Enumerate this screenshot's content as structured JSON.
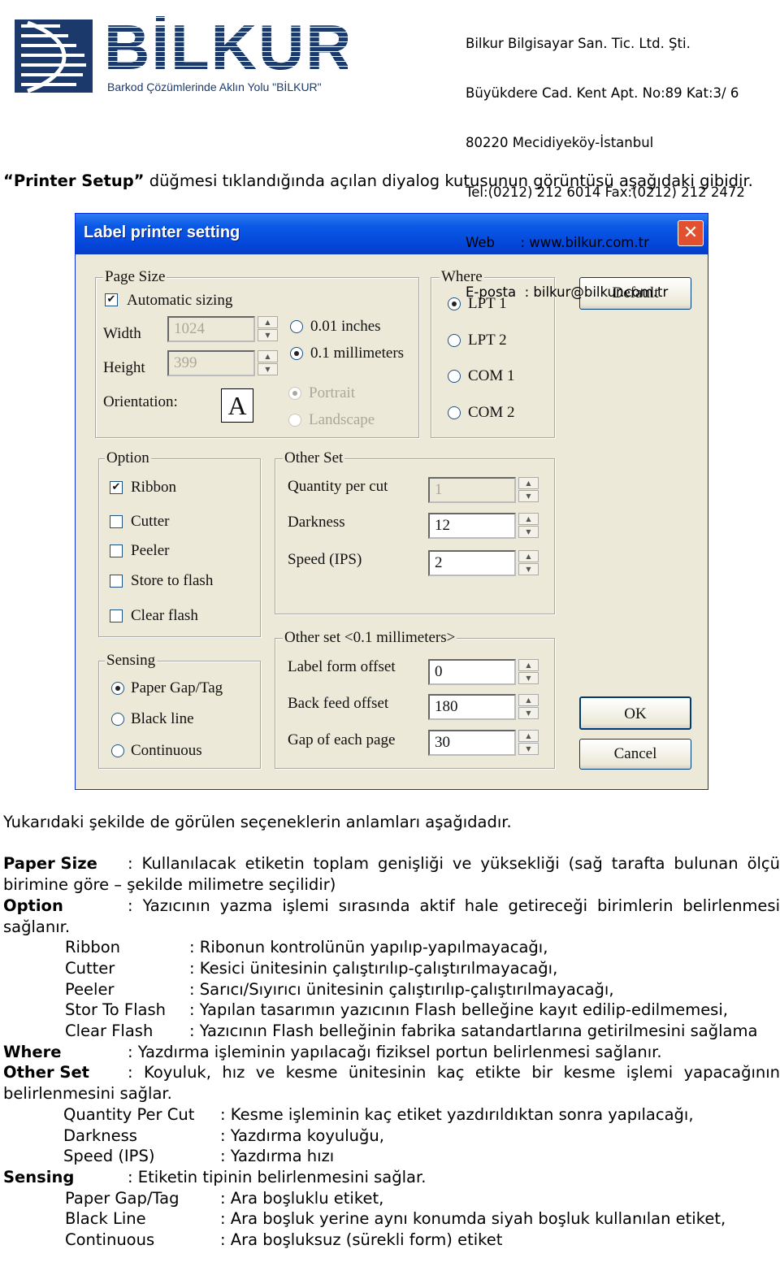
{
  "header": {
    "logo_text": "BİLKUR",
    "logo_slogan": "Barkod Çözümlerinde Aklın Yolu \"BİLKUR\"",
    "address_lines": [
      "Bilkur Bilgisayar San. Tic. Ltd. Şti.",
      "Büyükdere Cad. Kent Apt. No:89 Kat:3/ 6",
      "80220 Mecidiyeköy-İstanbul",
      "Tel:(0212) 212 6014 Fax:(0212) 212 2472",
      "Web      : www.bilkur.com.tr",
      "E-posta  : bilkur@bilkur.com.tr"
    ]
  },
  "intro": {
    "bold": "“Printer Setup”",
    "text": " düğmesi tıklandığında açılan diyalog kutusunun görüntüsü aşağıdaki gibidir."
  },
  "dialog": {
    "title": "Label printer setting",
    "close_icon": "close-icon",
    "page_size": {
      "legend": "Page Size",
      "automatic_sizing": {
        "label": "Automatic sizing",
        "checked": true
      },
      "width_label": "Width",
      "width_value": "1024",
      "height_label": "Height",
      "height_value": "399",
      "unit_inches": "0.01 inches",
      "unit_mm": "0.1 millimeters",
      "selected_unit": "0.1 millimeters",
      "orientation_label": "Orientation:",
      "orientation_icon_letter": "A",
      "portrait": "Portrait",
      "landscape": "Landscape",
      "selected_orientation": "Portrait"
    },
    "where": {
      "legend": "Where",
      "ports": [
        "LPT 1",
        "LPT 2",
        "COM 1",
        "COM 2"
      ],
      "selected": "LPT 1"
    },
    "default_button": "Default",
    "option": {
      "legend": "Option",
      "items": [
        {
          "label": "Ribbon",
          "checked": true
        },
        {
          "label": "Cutter",
          "checked": false
        },
        {
          "label": "Peeler",
          "checked": false
        },
        {
          "label": "Store to flash",
          "checked": false
        },
        {
          "label": "Clear flash",
          "checked": false
        }
      ]
    },
    "other_set": {
      "legend": "Other Set",
      "fields": [
        {
          "label": "Quantity per cut",
          "value": "1",
          "disabled": true
        },
        {
          "label": "Darkness",
          "value": "12"
        },
        {
          "label": "Speed (IPS)",
          "value": "2"
        }
      ]
    },
    "sensing": {
      "legend": "Sensing",
      "options": [
        "Paper Gap/Tag",
        "Black line",
        "Continuous"
      ],
      "selected": "Paper Gap/Tag"
    },
    "other_set_mm": {
      "legend": "Other set <0.1 millimeters>",
      "fields": [
        {
          "label": "Label form offset",
          "value": "0"
        },
        {
          "label": "Back feed offset",
          "value": "180"
        },
        {
          "label": "Gap of each page",
          "value": "30"
        }
      ]
    },
    "ok_button": "OK",
    "cancel_button": "Cancel"
  },
  "explanation": {
    "lead": "Yukarıdaki şekilde de görülen seçeneklerin anlamları aşağıdadır.",
    "paper_size": {
      "label": "Paper Size",
      "text": ": Kullanılacak etiketin toplam genişliği ve yüksekliği (sağ tarafta bulunan ölçü birimine göre – şekilde milimetre seçilidir)"
    },
    "option": {
      "label": "Option",
      "text": ": Yazıcının yazma işlemi sırasında aktif hale getireceği birimlerin belirlenmesi sağlanır."
    },
    "option_items": [
      {
        "label": "Ribbon",
        "text": ": Ribonun kontrolünün yapılıp-yapılmayacağı,"
      },
      {
        "label": "Cutter",
        "text": ": Kesici ünitesinin çalıştırılıp-çalıştırılmayacağı,"
      },
      {
        "label": "Peeler",
        "text": ": Sarıcı/Sıyırıcı ünitesinin çalıştırılıp-çalıştırılmayacağı,"
      },
      {
        "label": "Stor To Flash",
        "text": ": Yapılan tasarımın yazıcının Flash belleğine kayıt edilip-edilmemesi,"
      }
    ],
    "clear_flash": {
      "label": "Clear Flash",
      "text": ":  Yazıcının Flash belleğinin fabrika satandartlarına getirilmesini sağlama"
    },
    "where": {
      "label": "Where",
      "text": ": Yazdırma işleminin yapılacağı fiziksel portun belirlenmesi sağlanır."
    },
    "other_set": {
      "label": "Other Set",
      "text": ": Koyuluk, hız ve kesme ünitesinin kaç etikte bir kesme işlemi yapacağının belirlenmesini sağlar."
    },
    "other_set_items": [
      {
        "label": "Quantity Per Cut",
        "text": ": Kesme işleminin kaç etiket yazdırıldıktan sonra yapılacağı,"
      },
      {
        "label": "Darkness",
        "text": ": Yazdırma koyuluğu,"
      },
      {
        "label": "Speed (IPS)",
        "text": ": Yazdırma hızı"
      }
    ],
    "sensing": {
      "label": "Sensing",
      "text": ": Etiketin tipinin belirlenmesini sağlar."
    },
    "sensing_items": [
      {
        "label": "Paper Gap/Tag",
        "text": ": Ara boşluklu etiket,"
      },
      {
        "label": "Black Line",
        "text": ": Ara boşluk yerine aynı konumda siyah boşluk kullanılan etiket,"
      },
      {
        "label": "Continuous",
        "text": ": Ara boşluksuz (sürekli form) etiket"
      }
    ]
  },
  "colors": {
    "brand_navy": "#1b3a6b",
    "titlebar_blue": "#0a5ae6",
    "dialog_bg": "#ece9d8"
  }
}
